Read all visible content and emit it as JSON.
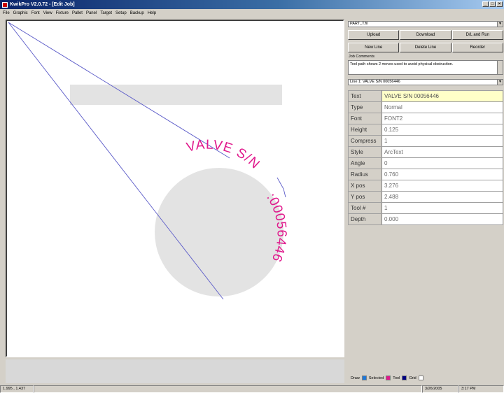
{
  "window": {
    "title": "KwikPro V2.0.72 - [Edit Job]",
    "controls": [
      "_",
      "□",
      "×"
    ]
  },
  "menu": [
    "File",
    "Graphic",
    "Font",
    "View",
    "Fixture",
    "Pallet",
    "Panel",
    "Target",
    "Setup",
    "Backup",
    "Help"
  ],
  "part_select": {
    "value": "PART_T.fil"
  },
  "buttons": {
    "row1": [
      "Upload",
      "Download",
      "D/L and Run"
    ],
    "row2": [
      "New Line",
      "Delete Line",
      "Reorder"
    ]
  },
  "job_comments": {
    "label": "Job Comments",
    "text": "Tool path shows 2 moves used to avoid physical obstruction."
  },
  "line_select": {
    "value": "Line 1: VALVE S/N 00056446"
  },
  "properties": [
    {
      "key": "Text",
      "value": "VALVE S/N 00056446"
    },
    {
      "key": "Type",
      "value": "Normal"
    },
    {
      "key": "Font",
      "value": "FONT2"
    },
    {
      "key": "Height",
      "value": "0.125"
    },
    {
      "key": "Compress",
      "value": "1"
    },
    {
      "key": "Style",
      "value": "ArcText"
    },
    {
      "key": "Angle",
      "value": "0"
    },
    {
      "key": "Radius",
      "value": "0.760"
    },
    {
      "key": "X pos",
      "value": "3.276"
    },
    {
      "key": "Y pos",
      "value": "2.488"
    },
    {
      "key": "Tool #",
      "value": "1"
    },
    {
      "key": "Depth",
      "value": "0.000"
    }
  ],
  "canvas": {
    "arc_text_upper": "VALVE S/N",
    "arc_text_lower": ":00056446",
    "colors": {
      "text": "#e0198c",
      "tool_path": "#5a5ac8",
      "obstruction": "#e3e3e3"
    }
  },
  "legend": {
    "draw": {
      "label": "Draw",
      "color": "#1e78d8"
    },
    "selected": {
      "label": "Selected",
      "color": "#e0198c"
    },
    "tool": {
      "label": "Tool",
      "color": "#000080"
    },
    "grid": {
      "label": "Grid",
      "color": "#ffffff"
    }
  },
  "status": {
    "coords": "1.995 , 1.437",
    "date": "3/26/2005",
    "time": "3:17 PM"
  }
}
